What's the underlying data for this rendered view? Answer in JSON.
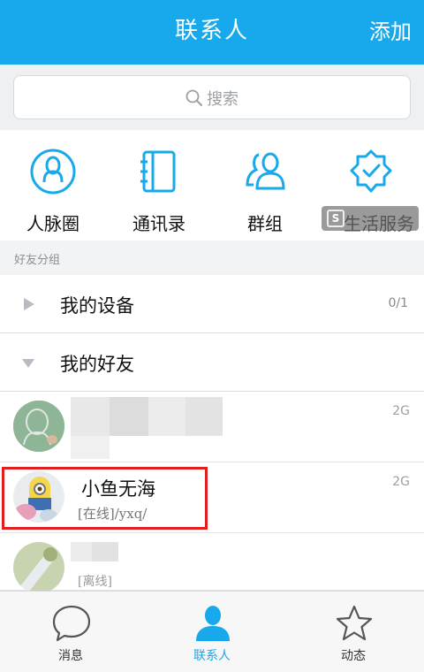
{
  "header": {
    "title": "联系人",
    "add_label": "添加"
  },
  "search": {
    "placeholder": "搜索"
  },
  "quick_actions": [
    {
      "label": "人脉圈",
      "icon": "person-circle-icon"
    },
    {
      "label": "通讯录",
      "icon": "address-book-icon"
    },
    {
      "label": "群组",
      "icon": "group-icon"
    },
    {
      "label": "生活服务",
      "icon": "badge-check-icon"
    }
  ],
  "section_label": "好友分组",
  "groups": [
    {
      "name": "我的设备",
      "count": "0/1",
      "expanded": false
    },
    {
      "name": "我的好友",
      "count": "",
      "expanded": true
    }
  ],
  "friends": [
    {
      "name": "",
      "status": "",
      "network": "2G"
    },
    {
      "name": "小鱼无海",
      "status": "[在线]/yxq/",
      "network": "2G"
    },
    {
      "name": "",
      "status": "[离线]",
      "network": ""
    }
  ],
  "tabs": [
    {
      "label": "消息",
      "icon": "chat-bubble-icon",
      "active": false
    },
    {
      "label": "联系人",
      "icon": "contact-person-icon",
      "active": true
    },
    {
      "label": "动态",
      "icon": "star-icon",
      "active": false
    }
  ],
  "colors": {
    "accent": "#17a9ec",
    "highlight": "#e01e1e"
  }
}
